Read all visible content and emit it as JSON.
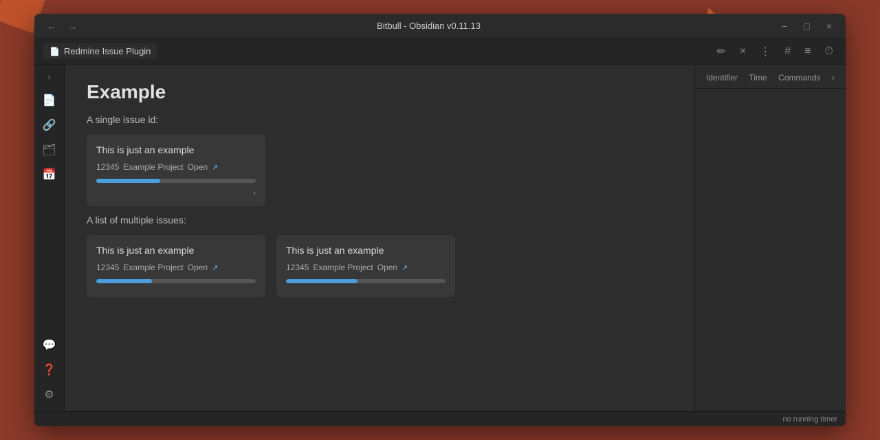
{
  "window": {
    "title": "Bitbull - Obsidian v0.11.13",
    "minimize_label": "−",
    "maximize_label": "□",
    "close_label": "×"
  },
  "titlebar": {
    "back_label": "←",
    "forward_label": "→"
  },
  "tab": {
    "icon": "📄",
    "label": "Redmine Issue Plugin",
    "edit_icon": "✏",
    "close_icon": "×",
    "more_icon": "⋮",
    "hash_icon": "#",
    "list_icon": "≡",
    "clock_icon": "⏱"
  },
  "sidebar": {
    "chevron": "›",
    "icons": [
      "📄",
      "🔗",
      "🗂",
      "📅",
      "💬",
      "❓",
      "⚙"
    ]
  },
  "right_panel": {
    "col1": "Identifier",
    "col2": "Time",
    "col3": "Commands",
    "chevron": "›"
  },
  "page": {
    "title": "Example",
    "section1_label": "A single issue id:",
    "section2_label": "A list of multiple issues:"
  },
  "single_issue": {
    "title": "This is just an example",
    "id": "12345",
    "project": "Example Project",
    "status": "Open",
    "progress": 40,
    "total": 100,
    "expand_icon": "›"
  },
  "multi_issues": [
    {
      "title": "This is just an example",
      "id": "12345",
      "project": "Example Project",
      "status": "Open",
      "progress": 35
    },
    {
      "title": "This is just an example",
      "id": "12345",
      "project": "Example Project",
      "status": "Open",
      "progress": 45
    }
  ],
  "status_bar": {
    "text": "no running timer"
  },
  "colors": {
    "progress_blue": "#4A9EDE",
    "progress_bg": "#555"
  }
}
